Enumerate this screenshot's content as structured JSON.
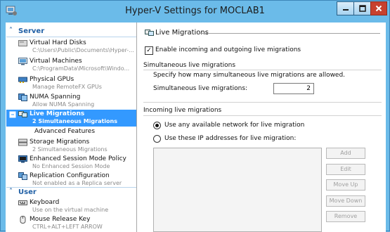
{
  "window": {
    "title": "Hyper-V Settings for MOCLAB1"
  },
  "sidebar": {
    "sections": [
      {
        "label": "Server"
      },
      {
        "label": "User"
      }
    ],
    "items": [
      {
        "label": "Virtual Hard Disks",
        "sub": "C:\\Users\\Public\\Documents\\Hyper-...",
        "icon": "virtual-hard-disk-icon"
      },
      {
        "label": "Virtual Machines",
        "sub": "C:\\ProgramData\\Microsoft\\Windo...",
        "icon": "virtual-machine-icon"
      },
      {
        "label": "Physical GPUs",
        "sub": "Manage RemoteFX GPUs",
        "icon": "gpu-icon"
      },
      {
        "label": "NUMA Spanning",
        "sub": "Allow NUMA Spanning",
        "icon": "numa-icon"
      },
      {
        "label": "Live Migrations",
        "sub": "2 Simultaneous Migrations",
        "icon": "live-migration-icon",
        "selected": true
      },
      {
        "label": "Advanced Features",
        "sub": "",
        "icon": ""
      },
      {
        "label": "Storage Migrations",
        "sub": "2 Simultaneous Migrations",
        "icon": "storage-migration-icon"
      },
      {
        "label": "Enhanced Session Mode Policy",
        "sub": "No Enhanced Session Mode",
        "icon": "session-policy-icon"
      },
      {
        "label": "Replication Configuration",
        "sub": "Not enabled as a Replica server",
        "icon": "replication-icon"
      },
      {
        "label": "Keyboard",
        "sub": "Use on the virtual machine",
        "icon": "keyboard-icon"
      },
      {
        "label": "Mouse Release Key",
        "sub": "CTRL+ALT+LEFT ARROW",
        "icon": "mouse-icon"
      }
    ]
  },
  "panel": {
    "heading": "Live Migrations",
    "enable_checkbox_label": "Enable incoming and outgoing live migrations",
    "enable_checked": true,
    "simultaneous": {
      "header": "Simultaneous live migrations",
      "description": "Specify how many simultaneous live migrations are allowed.",
      "field_label": "Simultaneous live migrations:",
      "value": "2"
    },
    "incoming": {
      "header": "Incoming live migrations",
      "option_any": "Use any available network for live migration",
      "option_ip": "Use these IP addresses for live migration:",
      "selected": "any"
    },
    "buttons": {
      "add": "Add",
      "edit": "Edit",
      "move_up": "Move Up",
      "move_down": "Move Down",
      "remove": "Remove"
    }
  },
  "colors": {
    "titlebar": "#6bbbe9",
    "selection": "#3399ff",
    "section_header": "#1f5fa5",
    "close_button": "#c7412e"
  }
}
